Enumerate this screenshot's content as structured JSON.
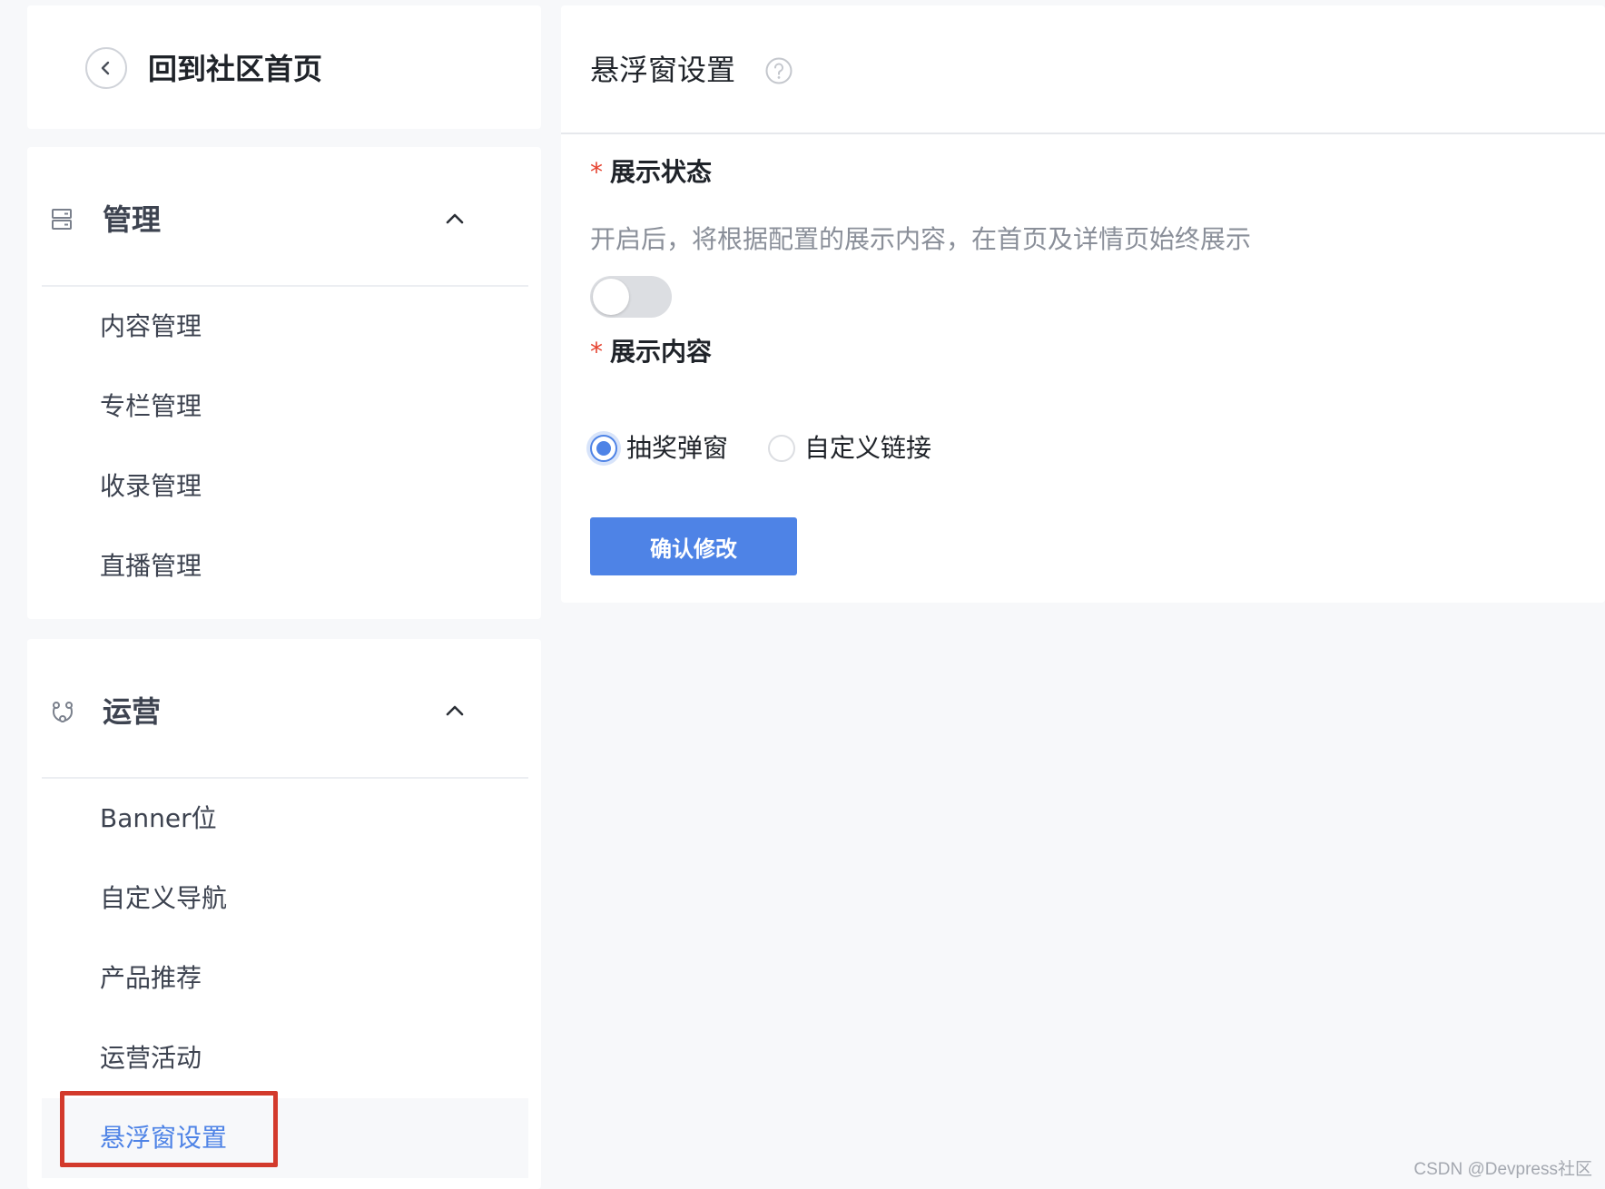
{
  "sidebar": {
    "back_label": "回到社区首页",
    "groups": [
      {
        "title": "管理",
        "icon": "server-icon",
        "items": [
          {
            "label": "内容管理"
          },
          {
            "label": "专栏管理"
          },
          {
            "label": "收录管理"
          },
          {
            "label": "直播管理"
          }
        ]
      },
      {
        "title": "运营",
        "icon": "operations-icon",
        "items": [
          {
            "label": "Banner位"
          },
          {
            "label": "自定义导航"
          },
          {
            "label": "产品推荐"
          },
          {
            "label": "运营活动"
          },
          {
            "label": "悬浮窗设置",
            "active": true
          }
        ]
      }
    ]
  },
  "main": {
    "title": "悬浮窗设置",
    "display_status": {
      "label": "展示状态",
      "required_mark": "*",
      "description": "开启后，将根据配置的展示内容，在首页及详情页始终展示",
      "enabled": false
    },
    "display_content": {
      "label": "展示内容",
      "required_mark": "*",
      "options": [
        {
          "label": "抽奖弹窗",
          "checked": true
        },
        {
          "label": "自定义链接",
          "checked": false
        }
      ]
    },
    "confirm_label": "确认修改"
  },
  "watermark": "CSDN @Devpress社区",
  "colors": {
    "accent": "#4e83e6",
    "required": "#e5422f",
    "highlight_box": "#d33a2c"
  }
}
